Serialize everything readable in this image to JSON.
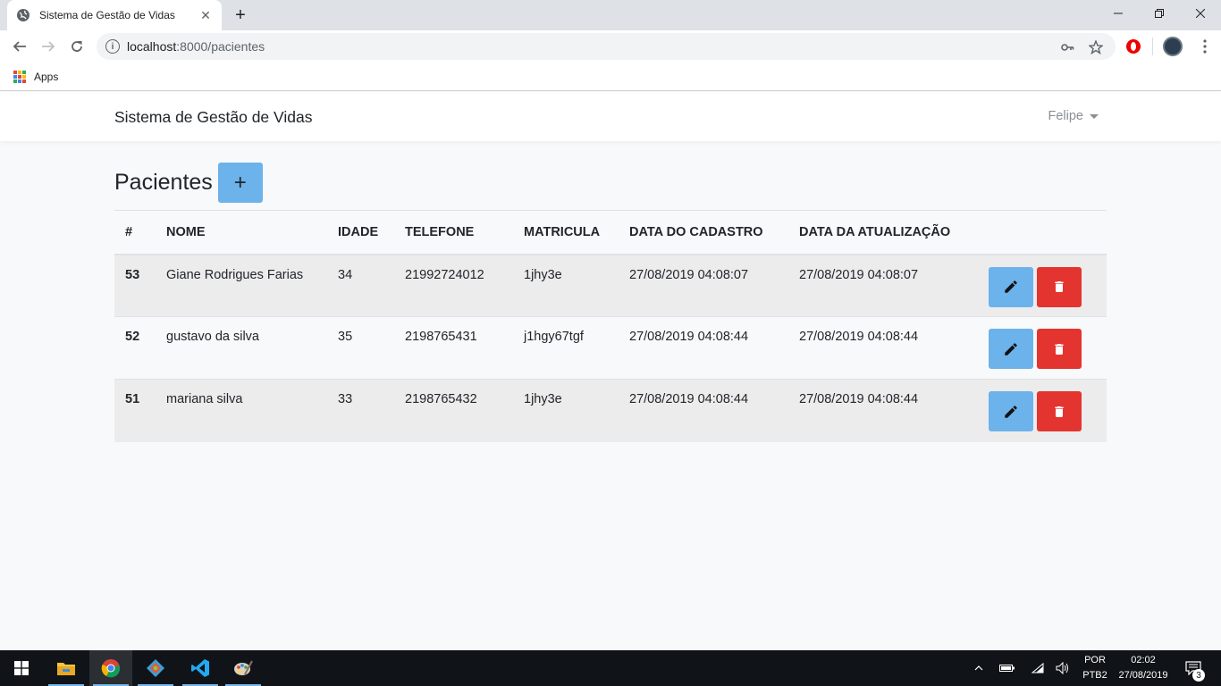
{
  "browser": {
    "tab_title": "Sistema de Gestão de Vidas",
    "new_tab_label": "+",
    "url_host": "localhost",
    "url_path": ":8000/pacientes",
    "bookmarks_apps_label": "Apps"
  },
  "navbar": {
    "brand": "Sistema de Gestão de Vidas",
    "user": "Felipe"
  },
  "page": {
    "title": "Pacientes",
    "add_label": "+"
  },
  "table": {
    "headers": [
      "#",
      "NOME",
      "IDADE",
      "TELEFONE",
      "MATRICULA",
      "DATA DO CADASTRO",
      "DATA DA ATUALIZAÇÃO"
    ],
    "rows": [
      {
        "id": "53",
        "nome": "Giane Rodrigues Farias",
        "idade": "34",
        "telefone": "21992724012",
        "matricula": "1jhy3e",
        "cadastro": "27/08/2019 04:08:07",
        "atualizacao": "27/08/2019 04:08:07"
      },
      {
        "id": "52",
        "nome": "gustavo da silva",
        "idade": "35",
        "telefone": "2198765431",
        "matricula": "j1hgy67tgf",
        "cadastro": "27/08/2019 04:08:44",
        "atualizacao": "27/08/2019 04:08:44"
      },
      {
        "id": "51",
        "nome": "mariana silva",
        "idade": "33",
        "telefone": "2198765432",
        "matricula": "1jhy3e",
        "cadastro": "27/08/2019 04:08:44",
        "atualizacao": "27/08/2019 04:08:44"
      }
    ]
  },
  "taskbar": {
    "lang_top": "POR",
    "lang_bottom": "PTB2",
    "time": "02:02",
    "date": "27/08/2019",
    "notifications": "3"
  },
  "colors": {
    "primary": "#6cb2eb",
    "danger": "#e3342f",
    "page_bg": "#f8f9fa"
  }
}
